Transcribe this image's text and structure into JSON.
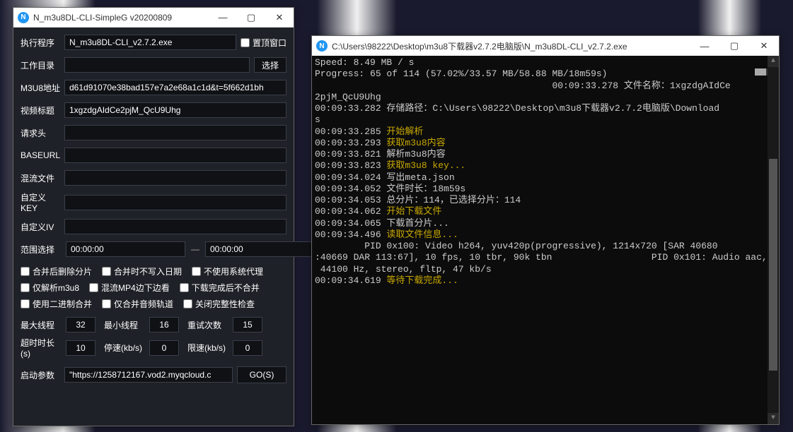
{
  "left": {
    "title": "N_m3u8DL-CLI-SimpleG v20200809",
    "labels": {
      "exe": "执行程序",
      "exe_val": "N_m3u8DL-CLI_v2.7.2.exe",
      "pin": "置顶窗口",
      "workdir": "工作目录",
      "choose": "选择",
      "m3u8": "M3U8地址",
      "m3u8_val": "d61d91070e38bad157e7a2e68a1c1d&t=5f662d1bh",
      "title_l": "视频标题",
      "title_val": "1xgzdgAIdCe2pjM_QcU9Uhg",
      "headers": "请求头",
      "baseurl": "BASEURL",
      "mux": "混流文件",
      "key": "自定义KEY",
      "iv": "自定义IV",
      "range": "范围选择",
      "range_start": "00:00:00",
      "range_end": "00:00:00",
      "chk1": "合并后删除分片",
      "chk2": "合并时不写入日期",
      "chk3": "不使用系统代理",
      "chk4": "仅解析m3u8",
      "chk5": "混流MP4边下边看",
      "chk6": "下载完成后不合并",
      "chk7": "使用二进制合并",
      "chk8": "仅合并音频轨道",
      "chk9": "关闭完整性检查",
      "maxthread": "最大线程",
      "maxthread_v": "32",
      "minthread": "最小线程",
      "minthread_v": "16",
      "retry": "重试次数",
      "retry_v": "15",
      "timeout": "超时时长(s)",
      "timeout_v": "10",
      "stopspeed": "停速(kb/s)",
      "stopspeed_v": "0",
      "limitspeed": "限速(kb/s)",
      "limitspeed_v": "0",
      "launch": "启动参数",
      "launch_val": "\"https://1258712167.vod2.myqcloud.c",
      "go": "GO(S)"
    }
  },
  "right": {
    "title": "C:\\Users\\98222\\Desktop\\m3u8下载器v2.7.2电脑版\\N_m3u8DL-CLI_v2.7.2.exe",
    "lines": [
      {
        "t": "Speed: 8.49 MB / s",
        "c": "w"
      },
      {
        "t": "Progress: 65 of 114 (57.02%/33.57 MB/58.88 MB/18m59s)",
        "c": "w"
      },
      {
        "t": "",
        "c": "w"
      },
      {
        "t": "                                           00:09:33.278 文件名称：1xgzdgAIdCe",
        "c": "w"
      },
      {
        "t": "2pjM_QcU9Uhg",
        "c": "w"
      },
      {
        "t": "00:09:33.282 存储路径：C:\\Users\\98222\\Desktop\\m3u8下载器v2.7.2电脑版\\Download",
        "c": "w"
      },
      {
        "t": "s",
        "c": "w"
      },
      {
        "ts": "00:09:33.285 ",
        "msg": "开始解析",
        "c": "y"
      },
      {
        "ts": "00:09:33.293 ",
        "msg": "获取m3u8内容",
        "c": "y"
      },
      {
        "t": "00:09:33.821 解析m3u8内容",
        "c": "w"
      },
      {
        "ts": "00:09:33.823 ",
        "msg": "获取m3u8 key...",
        "c": "y"
      },
      {
        "t": "00:09:34.024 写出meta.json",
        "c": "w"
      },
      {
        "t": "00:09:34.052 文件时长：18m59s",
        "c": "w"
      },
      {
        "t": "00:09:34.053 总分片：114，已选择分片：114",
        "c": "w"
      },
      {
        "ts": "00:09:34.062 ",
        "msg": "开始下载文件",
        "c": "y"
      },
      {
        "t": "00:09:34.065 下载首分片...",
        "c": "w"
      },
      {
        "ts": "00:09:34.496 ",
        "msg": "读取文件信息...",
        "c": "y"
      },
      {
        "t": "         PID 0x100: Video h264, yuv420p(progressive), 1214x720 [SAR 40680",
        "c": "w"
      },
      {
        "t": ":40669 DAR 113:67], 10 fps, 10 tbr, 90k tbn                  PID 0x101: Audio aac,",
        "c": "w"
      },
      {
        "t": " 44100 Hz, stereo, fltp, 47 kb/s",
        "c": "w"
      },
      {
        "ts": "00:09:34.619 ",
        "msg": "等待下载完成...",
        "c": "y"
      }
    ]
  }
}
